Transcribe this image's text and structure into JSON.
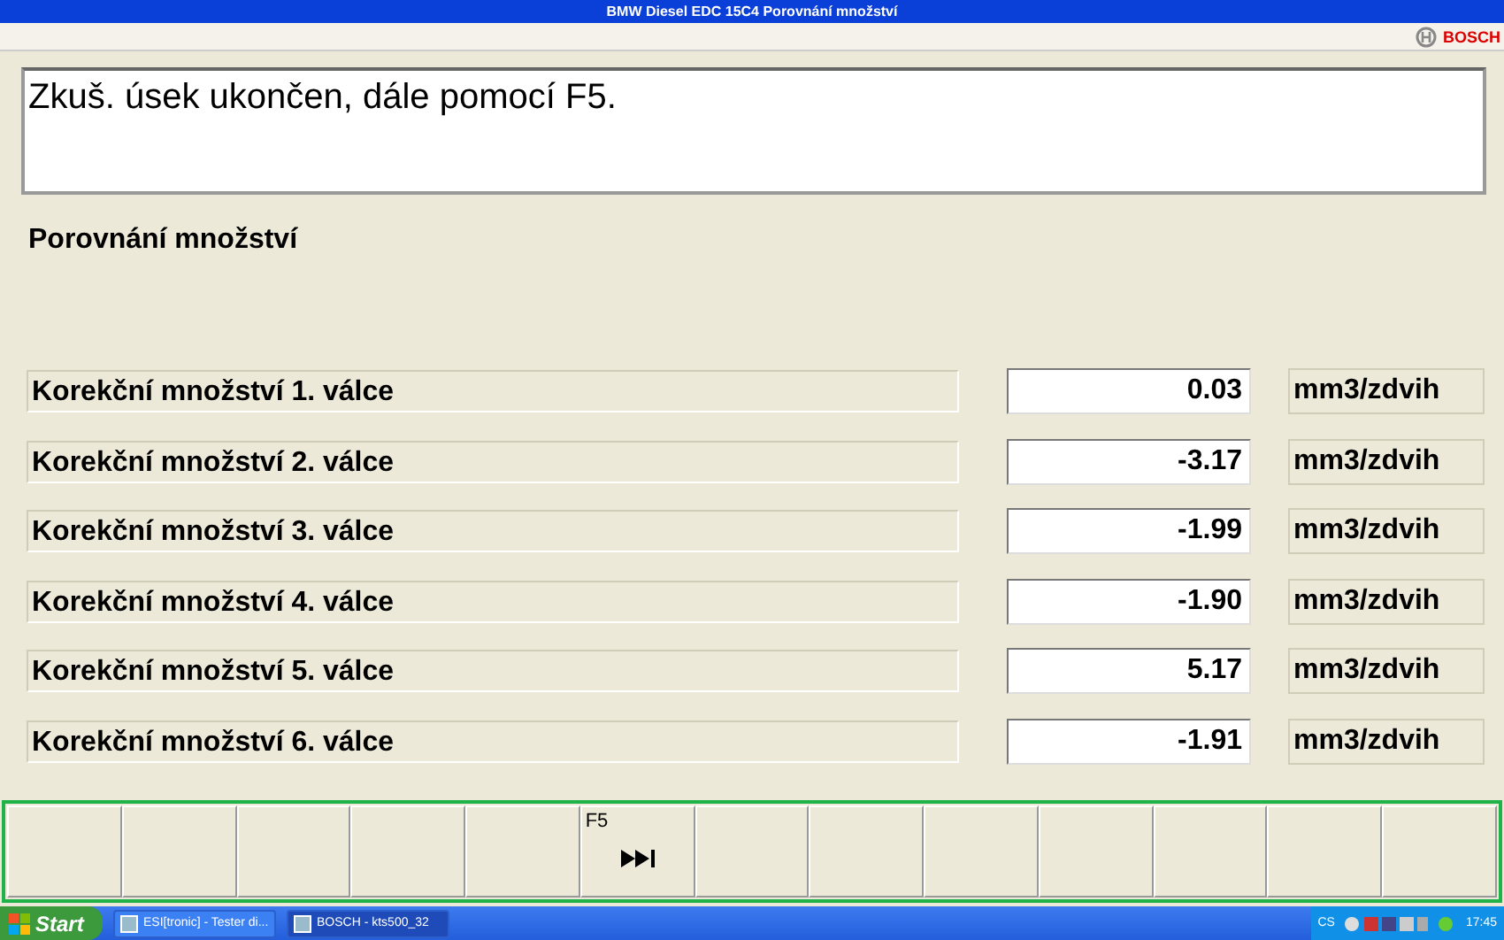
{
  "window": {
    "title": "BMW  Diesel EDC 15C4  Porovnání množství"
  },
  "brand": "BOSCH",
  "message": "Zkuš. úsek ukončen, dále pomocí F5.",
  "heading": "Porovnání množství",
  "rows": [
    {
      "label": "Korekční množství 1. válce",
      "value": "0.03",
      "unit": "mm3/zdvih"
    },
    {
      "label": "Korekční množství 2. válce",
      "value": "-3.17",
      "unit": "mm3/zdvih"
    },
    {
      "label": "Korekční množství 3. válce",
      "value": "-1.99",
      "unit": "mm3/zdvih"
    },
    {
      "label": "Korekční množství 4. válce",
      "value": "-1.90",
      "unit": "mm3/zdvih"
    },
    {
      "label": "Korekční množství 5. válce",
      "value": "5.17",
      "unit": "mm3/zdvih"
    },
    {
      "label": "Korekční množství 6. válce",
      "value": "-1.91",
      "unit": "mm3/zdvih"
    }
  ],
  "function_keys": [
    {
      "kind": "empty"
    },
    {
      "kind": "empty"
    },
    {
      "kind": "empty"
    },
    {
      "kind": "empty"
    },
    {
      "kind": "empty"
    },
    {
      "kind": "skip",
      "label": "F5"
    },
    {
      "kind": "empty"
    },
    {
      "kind": "empty"
    },
    {
      "kind": "empty"
    },
    {
      "kind": "empty"
    },
    {
      "kind": "empty"
    },
    {
      "kind": "empty"
    },
    {
      "kind": "empty"
    }
  ],
  "taskbar": {
    "start": "Start",
    "tasks": [
      {
        "label": "ESI[tronic] - Tester di...",
        "selected": false
      },
      {
        "label": "BOSCH - kts500_32",
        "selected": true
      }
    ],
    "language": "CS",
    "clock": "17:45"
  }
}
